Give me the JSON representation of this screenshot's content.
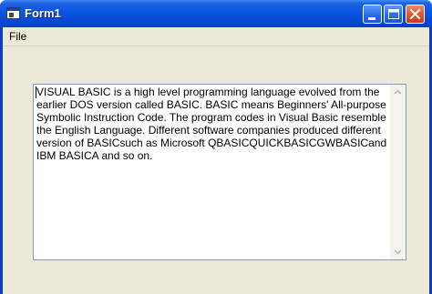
{
  "window": {
    "title": "Form1",
    "buttons": {
      "minimize": "minimize",
      "maximize": "maximize",
      "close": "close"
    }
  },
  "menu": {
    "items": [
      {
        "label": "File"
      }
    ]
  },
  "textbox": {
    "value": "VISUAL BASIC is a high level programming language evolved from the earlier DOS version called BASIC. BASIC means Beginners' All-purpose Symbolic Instruction Code. The program codes in Visual Basic resemble the English Language. Different software companies produced different version of BASICsuch as Microsoft QBASICQUICKBASICGWBASICand IBM BASICA and so on."
  },
  "colors": {
    "titlebar": "#0a55e0",
    "window_face": "#ece9d8",
    "textbox_border": "#7f9db9"
  },
  "icons": [
    "app-icon",
    "minimize-icon",
    "maximize-icon",
    "close-icon",
    "scroll-up-icon",
    "scroll-down-icon"
  ]
}
